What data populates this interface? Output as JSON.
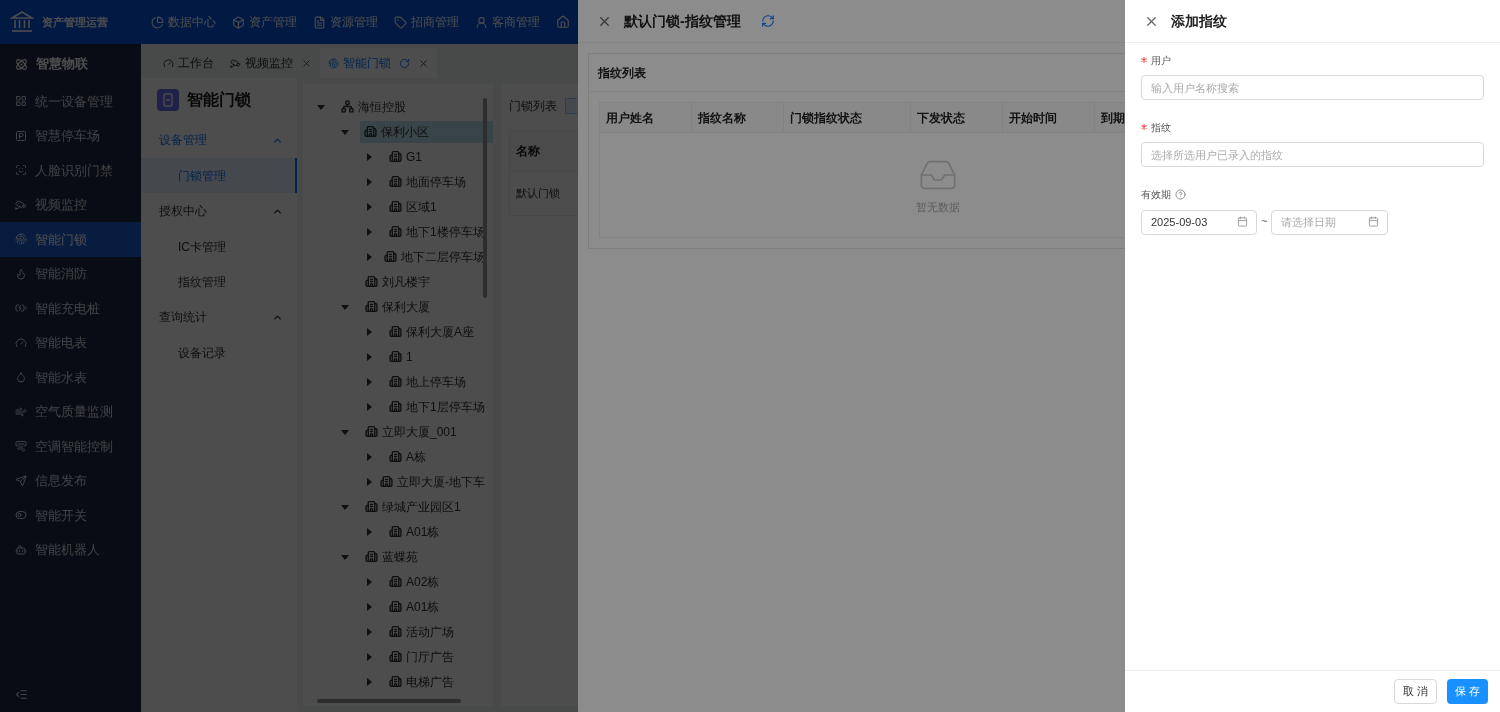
{
  "header": {
    "app_title": "资产管理运营",
    "nav": [
      {
        "label": "数据中心"
      },
      {
        "label": "资产管理"
      },
      {
        "label": "资源管理"
      },
      {
        "label": "招商管理"
      },
      {
        "label": "客商管理"
      }
    ]
  },
  "sidebar": {
    "heading": "智慧物联",
    "items": [
      {
        "label": "统一设备管理",
        "selected": false
      },
      {
        "label": "智慧停车场",
        "selected": false
      },
      {
        "label": "人脸识别门禁",
        "selected": false
      },
      {
        "label": "视频监控",
        "selected": false
      },
      {
        "label": "智能门锁",
        "selected": true
      },
      {
        "label": "智能消防",
        "selected": false
      },
      {
        "label": "智能充电桩",
        "selected": false
      },
      {
        "label": "智能电表",
        "selected": false
      },
      {
        "label": "智能水表",
        "selected": false
      },
      {
        "label": "空气质量监测",
        "selected": false
      },
      {
        "label": "空调智能控制",
        "selected": false
      },
      {
        "label": "信息发布",
        "selected": false
      },
      {
        "label": "智能开关",
        "selected": false
      },
      {
        "label": "智能机器人",
        "selected": false
      }
    ]
  },
  "tabs": [
    {
      "label": "工作台",
      "selected": false,
      "closable": false
    },
    {
      "label": "视频监控",
      "selected": false,
      "closable": true
    },
    {
      "label": "智能门锁",
      "selected": true,
      "closable": true
    }
  ],
  "submenu": {
    "title": "智能门锁",
    "groups": [
      {
        "label": "设备管理",
        "expanded": true,
        "items": [
          {
            "label": "门锁管理",
            "selected": true
          }
        ]
      },
      {
        "label": "授权中心",
        "expanded": true,
        "items": [
          {
            "label": "IC卡管理",
            "selected": false
          },
          {
            "label": "指纹管理",
            "selected": false
          }
        ]
      },
      {
        "label": "查询统计",
        "expanded": true,
        "items": [
          {
            "label": "设备记录",
            "selected": false
          }
        ]
      }
    ]
  },
  "tree": [
    {
      "label": "海恒控股",
      "kind": "root",
      "expanded": true,
      "selected": false,
      "children": [
        {
          "label": "保利小区",
          "kind": "branch",
          "expanded": true,
          "selected": true,
          "children": [
            {
              "label": "G1",
              "kind": "branch",
              "expanded": false,
              "selected": false
            },
            {
              "label": "地面停车场",
              "kind": "branch",
              "expanded": false,
              "selected": false
            },
            {
              "label": "区域1",
              "kind": "branch",
              "expanded": false,
              "selected": false
            },
            {
              "label": "地下1楼停车场",
              "kind": "branch",
              "expanded": false,
              "selected": false
            },
            {
              "label": "地下二层停车场",
              "kind": "branch",
              "expanded": false,
              "selected": false
            }
          ]
        },
        {
          "label": "刘凡楼宇",
          "kind": "leaf",
          "selected": false
        },
        {
          "label": "保利大厦",
          "kind": "branch",
          "expanded": true,
          "selected": false,
          "children": [
            {
              "label": "保利大厦A座",
              "kind": "branch",
              "expanded": false,
              "selected": false
            },
            {
              "label": "1",
              "kind": "branch",
              "expanded": false,
              "selected": false
            },
            {
              "label": "地上停车场",
              "kind": "branch",
              "expanded": false,
              "selected": false
            },
            {
              "label": "地下1层停车场",
              "kind": "branch",
              "expanded": false,
              "selected": false
            }
          ]
        },
        {
          "label": "立即大厦_001",
          "kind": "branch",
          "expanded": true,
          "selected": false,
          "children": [
            {
              "label": "A栋",
              "kind": "branch",
              "expanded": false,
              "selected": false
            },
            {
              "label": "立即大厦-地下车",
              "kind": "branch",
              "expanded": false,
              "selected": false
            }
          ]
        },
        {
          "label": "绿城产业园区1",
          "kind": "branch",
          "expanded": true,
          "selected": false,
          "children": [
            {
              "label": "A01栋",
              "kind": "branch",
              "expanded": false,
              "selected": false
            }
          ]
        },
        {
          "label": "蓝蝶苑",
          "kind": "branch",
          "expanded": true,
          "selected": false,
          "children": [
            {
              "label": "A02栋",
              "kind": "branch",
              "expanded": false,
              "selected": false
            },
            {
              "label": "A01栋",
              "kind": "branch",
              "expanded": false,
              "selected": false
            },
            {
              "label": "活动广场",
              "kind": "branch",
              "expanded": false,
              "selected": false
            },
            {
              "label": "门厅广告",
              "kind": "branch",
              "expanded": false,
              "selected": false
            },
            {
              "label": "电梯广告",
              "kind": "branch",
              "expanded": false,
              "selected": false
            }
          ]
        }
      ]
    }
  ],
  "lock_list": {
    "title": "门锁列表",
    "columns": [
      "名称"
    ],
    "rows": [
      [
        "默认门锁"
      ]
    ]
  },
  "fingerprint_drawer": {
    "title": "默认门锁-指纹管理",
    "card_title": "指纹列表",
    "columns": [
      "用户姓名",
      "指纹名称",
      "门锁指纹状态",
      "下发状态",
      "开始时间",
      "到期"
    ],
    "empty_text": "暂无数据"
  },
  "add_drawer": {
    "title": "添加指纹",
    "fields": [
      {
        "kind": "text",
        "label": "用户",
        "required": true,
        "placeholder": "输入用户名称搜索"
      },
      {
        "kind": "text",
        "label": "指纹",
        "required": true,
        "placeholder": "选择所选用户已录入的指纹"
      },
      {
        "kind": "daterange",
        "label": "有效期",
        "required": false,
        "start_value": "2025-09-03",
        "separator": "~",
        "end_placeholder": "请选择日期"
      }
    ],
    "buttons": [
      {
        "label": "取 消",
        "kind": "default"
      },
      {
        "label": "保 存",
        "kind": "primary"
      }
    ]
  }
}
